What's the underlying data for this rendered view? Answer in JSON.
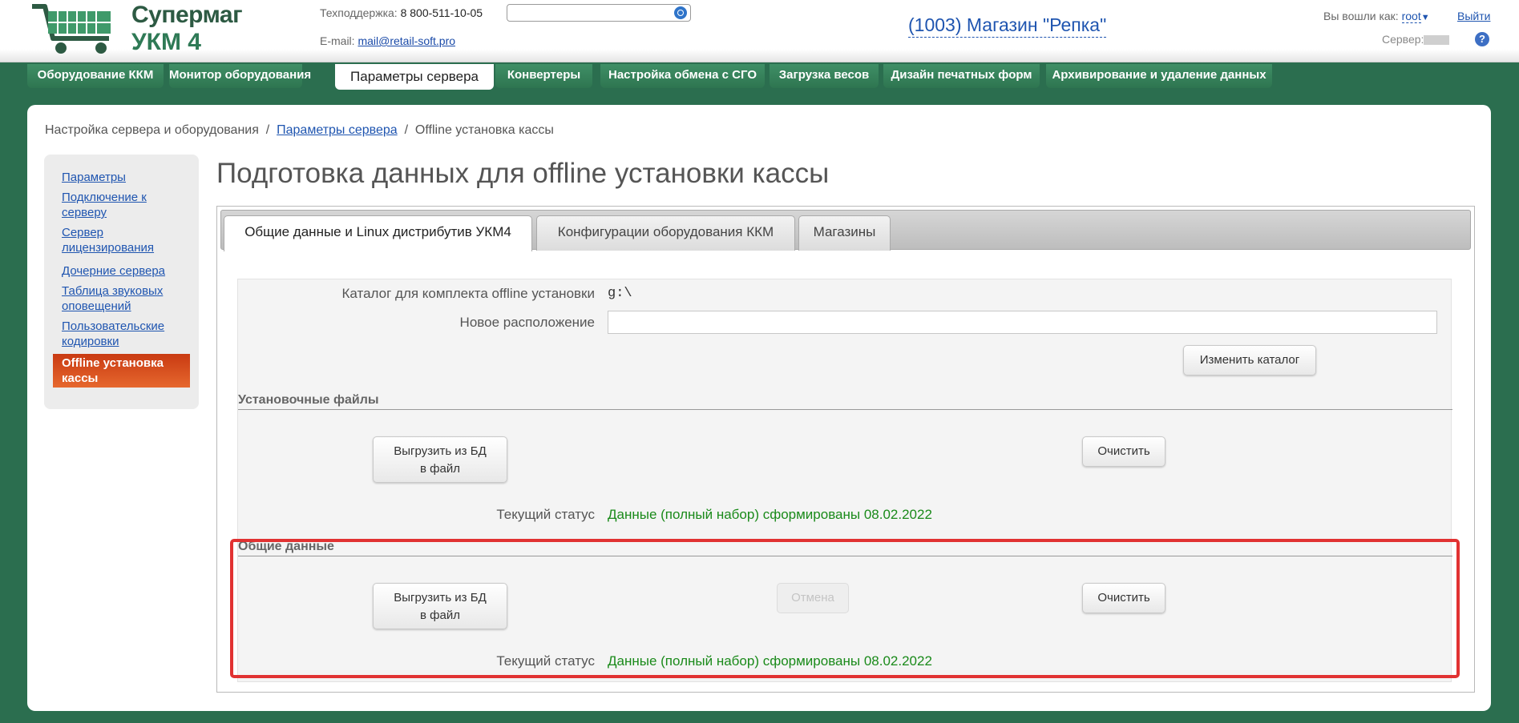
{
  "header": {
    "logo_line1": "Супермаг",
    "logo_line2": "УКМ 4",
    "support_label": "Техподдержка:",
    "support_phone": "8 800-511-10-05",
    "email_label": "E-mail:",
    "email": "mail@retail-soft.pro",
    "search_placeholder": "",
    "store": "(1003) Магазин \"Репка\"",
    "login_label": "Вы вошли как:",
    "user": "root",
    "logout": "Выйти",
    "server_label": "Сервер:",
    "help": "?"
  },
  "nav": {
    "tabs": [
      "Оборудование ККМ",
      "Монитор оборудования",
      "Параметры сервера",
      "Конвертеры",
      "Настройка обмена с СГО",
      "Загрузка весов",
      "Дизайн печатных форм",
      "Архивирование и удаление данных"
    ],
    "active_index": 2
  },
  "breadcrumb": {
    "root": "Настройка сервера и оборудования",
    "sep": "/",
    "parent": "Параметры сервера",
    "current": "Offline установка кассы"
  },
  "sidebar": {
    "items": [
      "Параметры",
      "Подключение к серверу",
      "Сервер лицензирования",
      "Дочерние сервера",
      "Таблица звуковых оповещений",
      "Пользовательские кодировки",
      "Offline установка кассы"
    ],
    "active_index": 6
  },
  "page_title": "Подготовка данных для offline установки кассы",
  "tabs": [
    "Общие данные и Linux дистрибутив УКМ4",
    "Конфигурации оборудования ККМ",
    "Магазины"
  ],
  "form": {
    "catalog_label": "Каталог для комплекта offline установки",
    "catalog_value": "g:\\",
    "new_location_label": "Новое расположение",
    "new_location_value": "",
    "change_catalog_button": "Изменить каталог",
    "install_files": {
      "title": "Установочные файлы",
      "export_button_line1": "Выгрузить из БД",
      "export_button_line2": "в файл",
      "clear_button": "Очистить",
      "status_label": "Текущий статус",
      "status_value": "Данные (полный набор) сформированы 08.02.2022"
    },
    "common_data": {
      "title": "Общие данные",
      "export_button_line1": "Выгрузить из БД",
      "export_button_line2": "в файл",
      "cancel_button": "Отмена",
      "clear_button": "Очистить",
      "status_label": "Текущий статус",
      "status_value": "Данные (полный набор) сформированы 08.02.2022"
    }
  },
  "colors": {
    "background": "#2b6e4f",
    "nav_tab": "#3f8f66",
    "link": "#1f55b0",
    "status_ok": "#1a8a1a",
    "active_sidebar": "#d9531f",
    "highlight": "#e13232"
  }
}
